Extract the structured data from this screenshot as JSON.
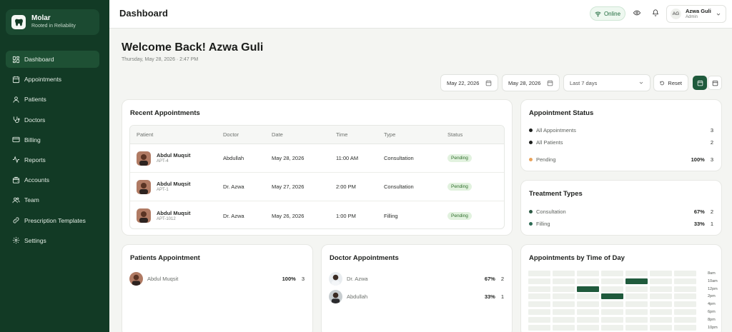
{
  "brand": {
    "name": "Molar",
    "tagline": "Rooted in Reliability"
  },
  "sidebar": {
    "items": [
      {
        "label": "Dashboard",
        "icon": "grid-icon",
        "active": true
      },
      {
        "label": "Appointments",
        "icon": "calendar-icon"
      },
      {
        "label": "Patients",
        "icon": "user-icon"
      },
      {
        "label": "Doctors",
        "icon": "stethoscope-icon"
      },
      {
        "label": "Billing",
        "icon": "credit-card-icon"
      },
      {
        "label": "Reports",
        "icon": "activity-icon"
      },
      {
        "label": "Accounts",
        "icon": "wallet-icon"
      },
      {
        "label": "Team",
        "icon": "users-icon"
      },
      {
        "label": "Prescription Templates",
        "icon": "link-icon"
      },
      {
        "label": "Settings",
        "icon": "gear-icon"
      }
    ]
  },
  "topbar": {
    "title": "Dashboard",
    "status": "Online",
    "user": {
      "initials": "AG",
      "name": "Azwa Guli",
      "role": "Admin"
    }
  },
  "welcome": {
    "heading": "Welcome Back! Azwa Guli",
    "datetime": "Thursday, May 28, 2026 · 2:47 PM"
  },
  "filters": {
    "from": "May 22, 2026",
    "to": "May 28, 2026",
    "range": "Last 7 days",
    "reset": "Reset"
  },
  "recent": {
    "title": "Recent Appointments",
    "columns": [
      "Patient",
      "Doctor",
      "Date",
      "Time",
      "Type",
      "Status"
    ],
    "rows": [
      {
        "patient": "Abdul Muqsit",
        "id": "APT-4",
        "doctor": "Abdullah",
        "date": "May 28, 2026",
        "time": "11:00 AM",
        "type": "Consultation",
        "status": "Pending"
      },
      {
        "patient": "Abdul Muqsit",
        "id": "APT-1",
        "doctor": "Dr. Azwa",
        "date": "May 27, 2026",
        "time": "2:00 PM",
        "type": "Consultation",
        "status": "Pending"
      },
      {
        "patient": "Abdul Muqsit",
        "id": "APT-1012",
        "doctor": "Dr. Azwa",
        "date": "May 26, 2026",
        "time": "1:00 PM",
        "type": "Filling",
        "status": "Pending"
      }
    ]
  },
  "status_card": {
    "title": "Appointment Status",
    "items": [
      {
        "label": "All Appointments",
        "pct": "",
        "value": "3",
        "color": "#1d1f1d"
      },
      {
        "label": "All Patients",
        "pct": "",
        "value": "2",
        "color": "#1d1f1d"
      },
      {
        "label": "Pending",
        "pct": "100%",
        "value": "3",
        "color": "#e8a25a"
      }
    ]
  },
  "treatment": {
    "title": "Treatment Types",
    "items": [
      {
        "label": "Consultation",
        "pct": "67%",
        "value": "2",
        "color": "#2d5a44"
      },
      {
        "label": "Filling",
        "pct": "33%",
        "value": "1",
        "color": "#2e6b54"
      }
    ]
  },
  "patients_appt": {
    "title": "Patients Appointment",
    "items": [
      {
        "name": "Abdul Muqsit",
        "pct": "100%",
        "value": "3"
      }
    ]
  },
  "doctor_appt": {
    "title": "Doctor Appointments",
    "items": [
      {
        "name": "Dr. Azwa",
        "pct": "67%",
        "value": "2"
      },
      {
        "name": "Abdullah",
        "pct": "33%",
        "value": "1"
      }
    ]
  },
  "time_of_day": {
    "title": "Appointments by Time of Day",
    "hours": [
      "8am",
      "10am",
      "12pm",
      "2pm",
      "4pm",
      "6pm",
      "8pm",
      "10pm"
    ],
    "active_cells": [
      {
        "day": 4,
        "hour": 1
      },
      {
        "day": 2,
        "hour": 2
      },
      {
        "day": 3,
        "hour": 3
      }
    ]
  }
}
